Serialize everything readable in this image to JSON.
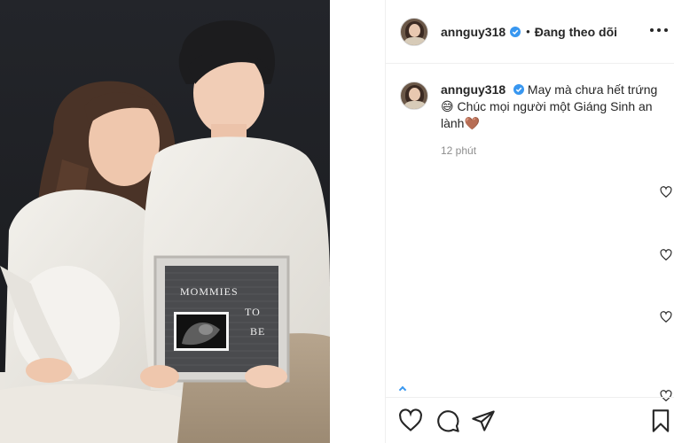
{
  "post": {
    "author": "annguy318",
    "verified": true,
    "follow_state": "Đang theo dõi",
    "separator": "•",
    "photo": {
      "letterboard_line1": "MOMMIES",
      "letterboard_line2": "TO",
      "letterboard_line3": "BE"
    }
  },
  "caption": {
    "author": "annguy318",
    "text_line1": "May mà chưa hết trứng",
    "text_line2": "😅 Chúc mọi người một Giáng Sinh an",
    "text_line3": "lành🤎",
    "time": "12 phút"
  },
  "icons": {
    "more": "more-options-icon",
    "verified": "verified-badge-icon",
    "comment_like": "heart-outline-icon",
    "like": "heart-icon",
    "comment": "comment-icon",
    "share": "paper-plane-icon",
    "save": "bookmark-icon"
  },
  "colors": {
    "verified_blue": "#3897f0",
    "text": "#262626",
    "muted": "#8e8e8e",
    "divider": "#efefef"
  }
}
